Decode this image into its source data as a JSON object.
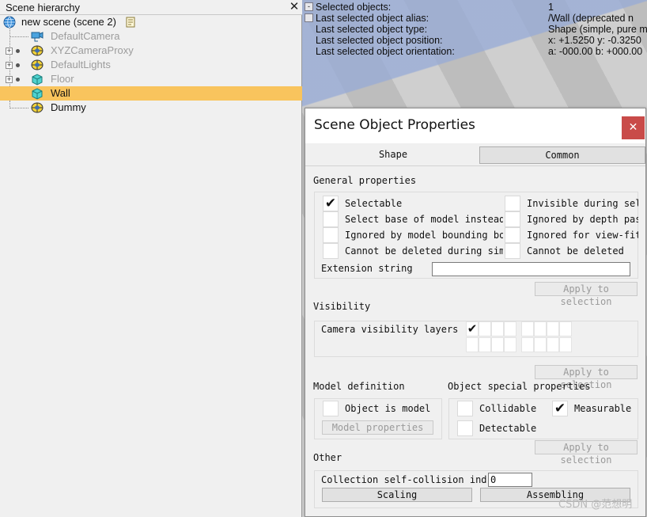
{
  "hierarchy": {
    "title": "Scene hierarchy",
    "close_glyph": "✕",
    "root_label": "new scene (scene 2)",
    "items": [
      {
        "label": "DefaultCamera",
        "icon": "camera-icon",
        "disabled": true
      },
      {
        "label": "XYZCameraProxy",
        "icon": "dummy-icon",
        "disabled": true
      },
      {
        "label": "DefaultLights",
        "icon": "dummy-icon",
        "disabled": true
      },
      {
        "label": "Floor",
        "icon": "shape-icon",
        "disabled": true
      },
      {
        "label": "Wall",
        "icon": "shape-icon",
        "selected": true
      },
      {
        "label": "Dummy",
        "icon": "dummy-icon"
      }
    ]
  },
  "info": {
    "rows": [
      {
        "label": "Selected objects:",
        "value": "1"
      },
      {
        "label": "Last selected object alias:",
        "value": "/Wall    (deprecated n"
      },
      {
        "label": "Last selected object type:",
        "value": "Shape (simple, pure m"
      },
      {
        "label": "Last selected object position:",
        "value": "x: +1.5250   y: -0.3250"
      },
      {
        "label": "Last selected object orientation:",
        "value": "a: -000.00   b: +000.00"
      }
    ]
  },
  "dialog": {
    "title": "Scene Object Properties",
    "close_glyph": "✕",
    "tabs": [
      "Shape",
      "Common"
    ],
    "general": {
      "heading": "General properties",
      "items": [
        {
          "label": "Selectable",
          "checked": true
        },
        {
          "label": "Invisible during sel",
          "checked": false
        },
        {
          "label": "Select base of model instead",
          "checked": false
        },
        {
          "label": "Ignored by depth pas",
          "checked": false
        },
        {
          "label": "Ignored by model bounding  bo",
          "checked": false
        },
        {
          "label": "Ignored for view-fit",
          "checked": false
        },
        {
          "label": "Cannot be deleted during simu",
          "checked": false
        },
        {
          "label": "Cannot be deleted",
          "checked": false
        }
      ],
      "extension_label": "Extension string",
      "extension_value": "",
      "apply_label": "Apply to selection"
    },
    "visibility": {
      "heading": "Visibility",
      "layers_label": "Camera visibility layers",
      "checked_glyph": "✔",
      "apply_label": "Apply to selection"
    },
    "model": {
      "heading": "Model definition",
      "object_is_model": "Object is model",
      "properties_button": "Model properties"
    },
    "special": {
      "heading": "Object special properties",
      "collidable": "Collidable",
      "measurable": "Measurable",
      "detectable": "Detectable",
      "checked_glyph": "✔",
      "apply_label": "Apply to selection"
    },
    "other": {
      "heading": "Other",
      "collection_label": "Collection self-collision ind",
      "collection_value": "0",
      "scaling_button": "Scaling",
      "assembling_button": "Assembling"
    }
  },
  "watermark": "CSDN @范想明",
  "colors": {
    "selection": "#f9c45d",
    "close_red": "#c94b49",
    "viewport_sky": "#9aaad7"
  }
}
